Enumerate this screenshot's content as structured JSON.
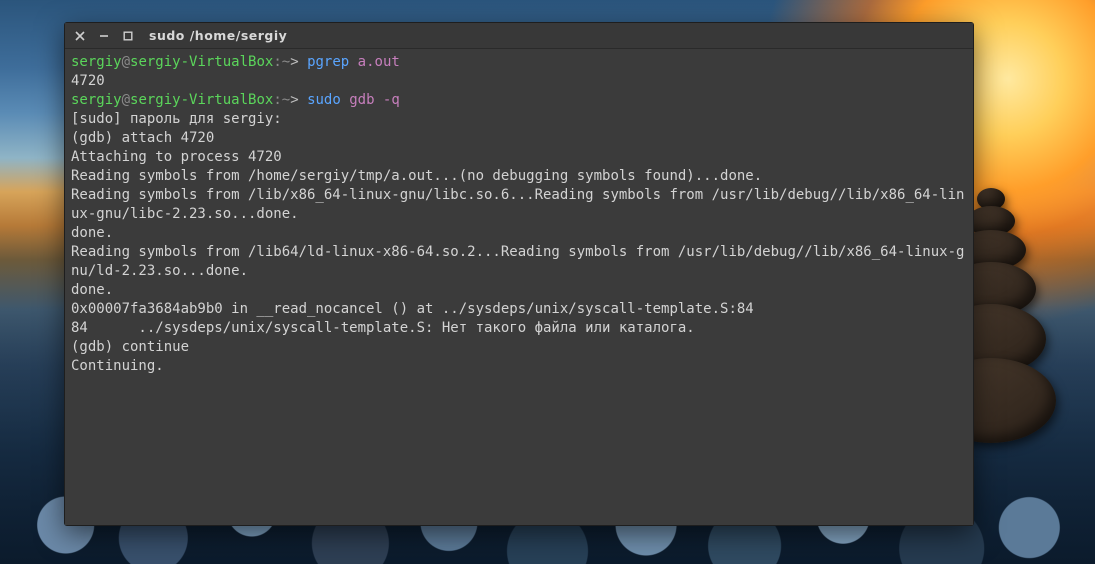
{
  "window": {
    "title": "sudo  /home/sergiy"
  },
  "prompt": {
    "user": "sergiy",
    "at": "@",
    "host": "sergiy-VirtualBox",
    "path": "~",
    "arrow": ">"
  },
  "lines": {
    "cmd1_name": "pgrep",
    "cmd1_arg": "a.out",
    "out_pid": "4720",
    "cmd2_name": "sudo",
    "cmd2_args": "gdb -q",
    "sudo_pw": "[sudo] пароль для sergiy:",
    "gdb_attach": "(gdb) attach 4720",
    "attaching": "Attaching to process 4720",
    "read1": "Reading symbols from /home/sergiy/tmp/a.out...(no debugging symbols found)...done.",
    "read2": "Reading symbols from /lib/x86_64-linux-gnu/libc.so.6...Reading symbols from /usr/lib/debug//lib/x86_64-linux-gnu/libc-2.23.so...done.",
    "done1": "done.",
    "read3": "Reading symbols from /lib64/ld-linux-x86-64.so.2...Reading symbols from /usr/lib/debug//lib/x86_64-linux-gnu/ld-2.23.so...done.",
    "done2": "done.",
    "break": "0x00007fa3684ab9b0 in __read_nocancel () at ../sysdeps/unix/syscall-template.S:84",
    "err": "84      ../sysdeps/unix/syscall-template.S: Нет такого файла или каталога.",
    "gdb_cont": "(gdb) continue",
    "continuing": "Continuing."
  }
}
